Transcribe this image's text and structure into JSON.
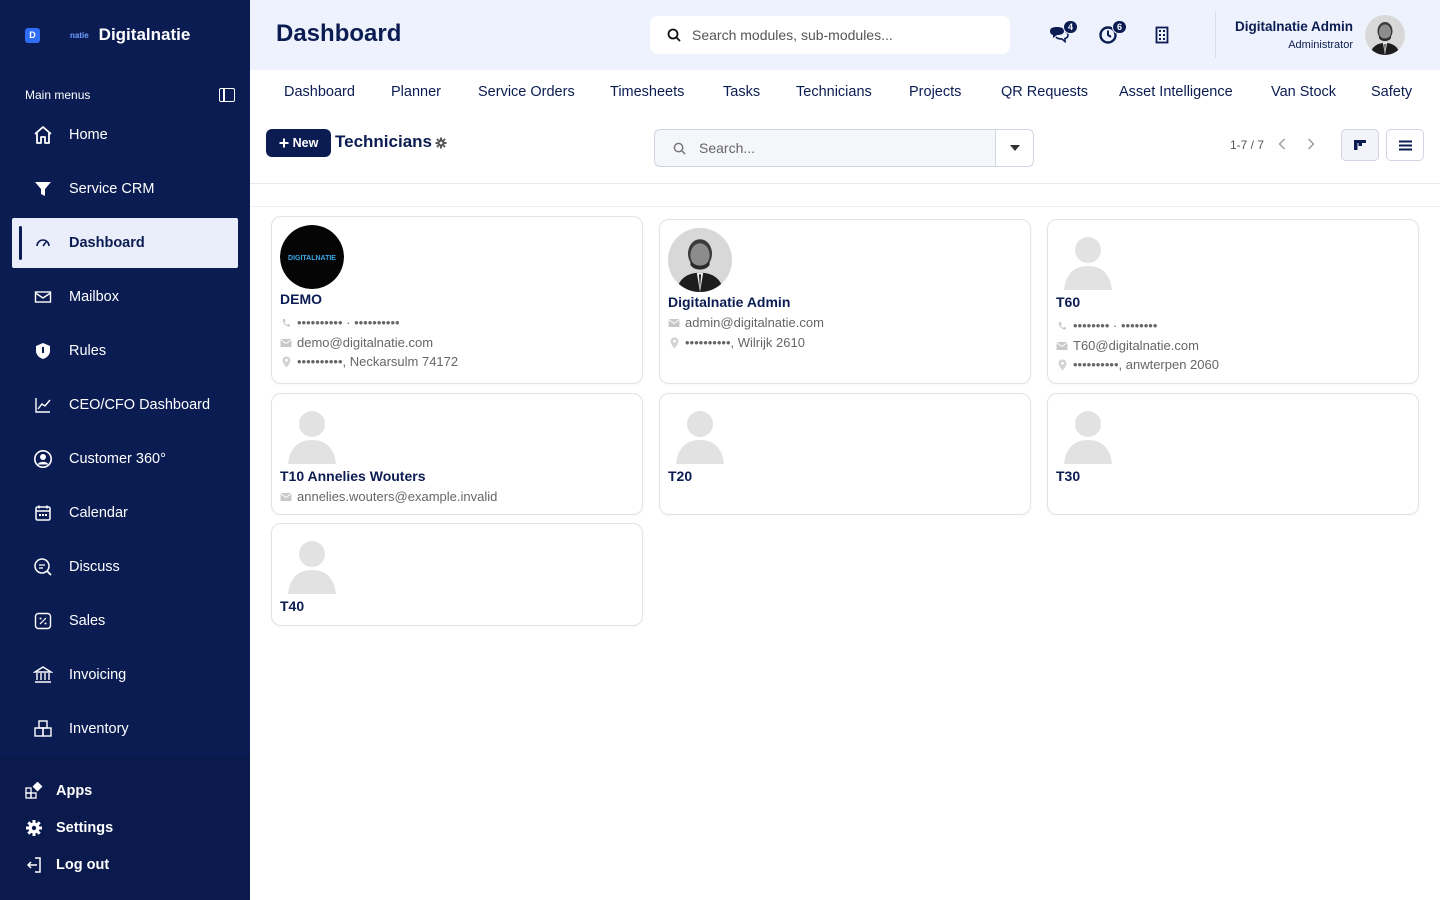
{
  "brand": {
    "badge": "D",
    "small": "natie",
    "name": "Digitalnatie"
  },
  "sidebar": {
    "heading": "Main menus",
    "items": [
      {
        "label": "Home",
        "icon": "home-icon"
      },
      {
        "label": "Service CRM",
        "icon": "filter-icon"
      },
      {
        "label": "Dashboard",
        "icon": "gauge-icon",
        "active": true
      },
      {
        "label": "Mailbox",
        "icon": "mail-icon"
      },
      {
        "label": "Rules",
        "icon": "shield-icon"
      },
      {
        "label": "CEO/CFO Dashboard",
        "icon": "chart-line-icon"
      },
      {
        "label": "Customer 360°",
        "icon": "user-circle-icon"
      },
      {
        "label": "Calendar",
        "icon": "calendar-icon"
      },
      {
        "label": "Discuss",
        "icon": "chat-search-icon"
      },
      {
        "label": "Sales",
        "icon": "percent-icon"
      },
      {
        "label": "Invoicing",
        "icon": "bank-icon"
      },
      {
        "label": "Inventory",
        "icon": "boxes-icon"
      }
    ],
    "bottom": [
      {
        "label": "Apps",
        "icon": "apps-icon"
      },
      {
        "label": "Settings",
        "icon": "gear-icon"
      },
      {
        "label": "Log out",
        "icon": "logout-icon"
      }
    ]
  },
  "header": {
    "title": "Dashboard",
    "search_placeholder": "Search modules, sub-modules...",
    "messages_count": "4",
    "activities_count": "6",
    "user_name": "Digitalnatie Admin",
    "user_role": "Administrator"
  },
  "subnav": [
    "Dashboard",
    "Planner",
    "Service Orders",
    "Timesheets",
    "Tasks",
    "Technicians",
    "Projects",
    "QR Requests",
    "Asset Intelligence",
    "Van Stock",
    "Safety"
  ],
  "controls": {
    "new_label": "New",
    "section_title": "Technicians",
    "search_placeholder": "Search...",
    "pager": "1-7 / 7"
  },
  "cards": [
    {
      "name": "DEMO",
      "avatar": "logo",
      "avatar_text": "DIGITALNATIE",
      "phone": "•••••••••• · ••••••••••",
      "email": "demo@digitalnatie.com",
      "address": "••••••••••, Neckarsulm 74172"
    },
    {
      "name": "Digitalnatie Admin",
      "avatar": "photo",
      "email": "admin@digitalnatie.com",
      "address": "••••••••••, Wilrijk 2610"
    },
    {
      "name": "T60",
      "avatar": "placeholder",
      "phone": "•••••••• · ••••••••",
      "email": "T60@digitalnatie.com",
      "address": "••••••••••, anwterpen 2060"
    },
    {
      "name": "T10 Annelies Wouters",
      "avatar": "placeholder",
      "email": "annelies.wouters@example.invalid"
    },
    {
      "name": "T20",
      "avatar": "placeholder"
    },
    {
      "name": "T30",
      "avatar": "placeholder"
    },
    {
      "name": "T40",
      "avatar": "placeholder"
    }
  ],
  "colors": {
    "sidebar": "#0b1c52",
    "accent": "#0b1c52",
    "topbar": "#eef2fc",
    "brand_badge": "#2f6df6"
  }
}
